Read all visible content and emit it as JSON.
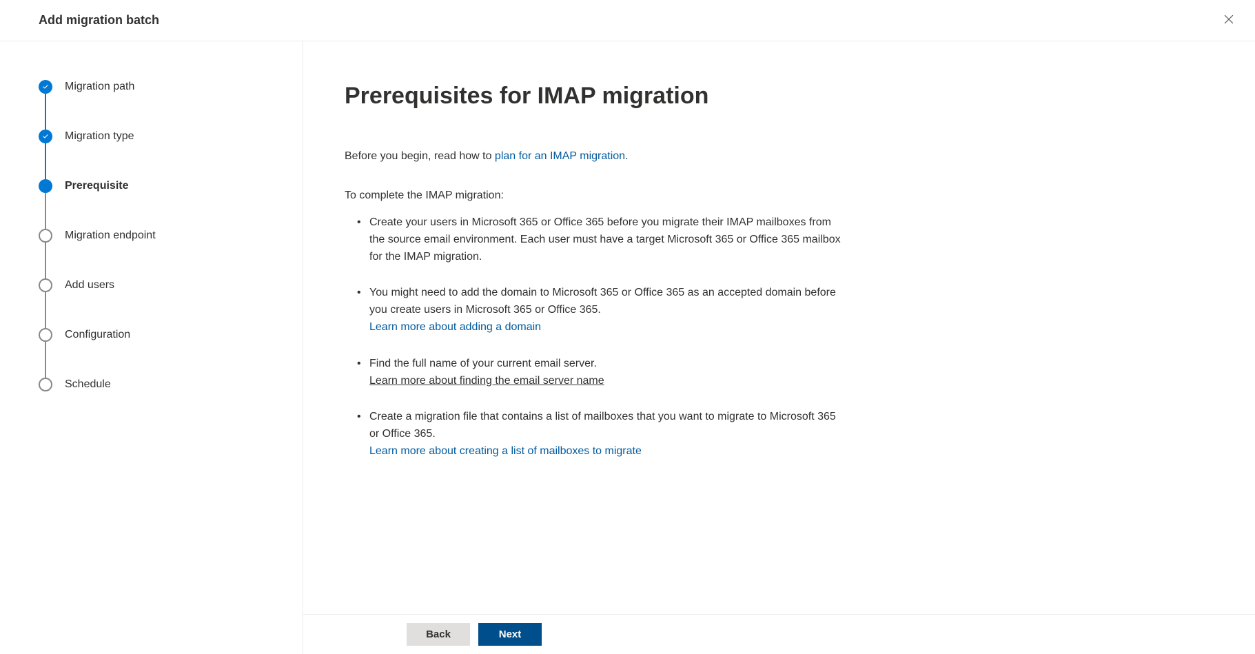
{
  "header": {
    "title": "Add migration batch"
  },
  "steps": [
    {
      "label": "Migration path",
      "state": "completed"
    },
    {
      "label": "Migration type",
      "state": "completed"
    },
    {
      "label": "Prerequisite",
      "state": "current"
    },
    {
      "label": "Migration endpoint",
      "state": "pending"
    },
    {
      "label": "Add users",
      "state": "pending"
    },
    {
      "label": "Configuration",
      "state": "pending"
    },
    {
      "label": "Schedule",
      "state": "pending"
    }
  ],
  "content": {
    "title": "Prerequisites for IMAP migration",
    "intro_prefix": "Before you begin, read how to ",
    "intro_link": "plan for an IMAP migration",
    "intro_suffix": ".",
    "subtitle": "To complete the IMAP migration:",
    "bullets": [
      {
        "text": "Create your users in Microsoft 365 or Office 365 before you migrate their IMAP mailboxes from the source email environment. Each user must have a target Microsoft 365 or Office 365 mailbox for the IMAP migration."
      },
      {
        "text": "You might need to add the domain to Microsoft 365 or Office 365 as an accepted domain before you create users in Microsoft 365 or Office 365.",
        "link": "Learn more about adding a domain",
        "link_style": "normal"
      },
      {
        "text": "Find the full name of your current email server.",
        "link": "Learn more about finding the email server name",
        "link_style": "underlined"
      },
      {
        "text": "Create a migration file that contains a list of mailboxes that you want to migrate to Microsoft 365 or Office 365.",
        "link": "Learn more about creating a list of mailboxes to migrate",
        "link_style": "normal"
      }
    ]
  },
  "footer": {
    "back": "Back",
    "next": "Next"
  }
}
